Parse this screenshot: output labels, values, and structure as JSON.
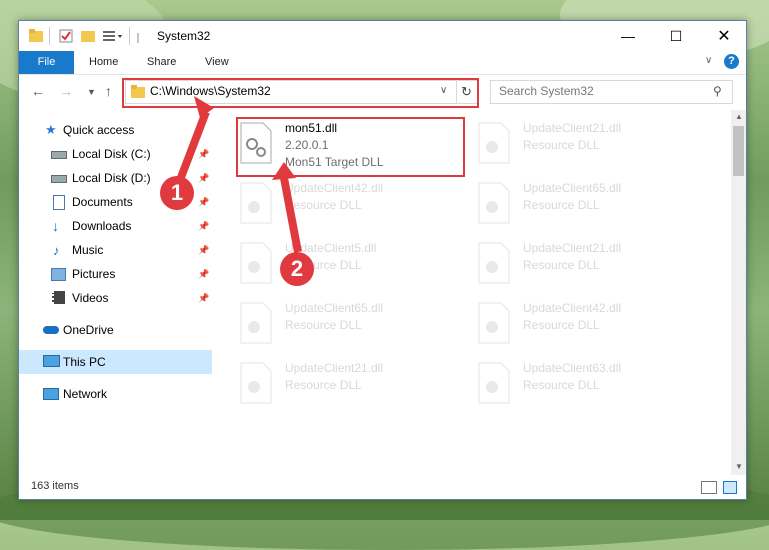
{
  "window": {
    "title": "System32"
  },
  "ribbon": {
    "tabs": [
      "File",
      "Home",
      "Share",
      "View"
    ]
  },
  "address": {
    "path": "C:\\Windows\\System32",
    "search_placeholder": "Search System32"
  },
  "nav": {
    "items": [
      {
        "label": "Quick access",
        "icon": "star-icon"
      },
      {
        "label": "Local Disk (C:)",
        "icon": "drive-icon"
      },
      {
        "label": "Local Disk (D:)",
        "icon": "drive-icon"
      },
      {
        "label": "Documents",
        "icon": "documents-icon"
      },
      {
        "label": "Downloads",
        "icon": "download-icon"
      },
      {
        "label": "Music",
        "icon": "music-icon"
      },
      {
        "label": "Pictures",
        "icon": "pictures-icon"
      },
      {
        "label": "Videos",
        "icon": "videos-icon"
      },
      {
        "label": "OneDrive",
        "icon": "cloud-icon"
      },
      {
        "label": "This PC",
        "icon": "computer-icon"
      },
      {
        "label": "Network",
        "icon": "network-icon"
      }
    ]
  },
  "files": {
    "main": {
      "name": "mon51.dll",
      "version": "2.20.0.1",
      "desc": "Mon51 Target DLL"
    },
    "faded": [
      {
        "name": "UpdateClient21.dll",
        "desc": "Resource DLL"
      },
      {
        "name": "UpdateClient42.dll",
        "desc": "Resource DLL"
      },
      {
        "name": "UpdateClient65.dll",
        "desc": "Resource DLL"
      },
      {
        "name": "UpdateClient5.dll",
        "desc": "Resource DLL"
      },
      {
        "name": "UpdateClient21.dll",
        "desc": "Resource DLL"
      },
      {
        "name": "UpdateClient65.dll",
        "desc": "Resource DLL"
      },
      {
        "name": "UpdateClient42.dll",
        "desc": "Resource DLL"
      },
      {
        "name": "UpdateClient21.dll",
        "desc": "Resource DLL"
      },
      {
        "name": "UpdateClient63.dll",
        "desc": "Resource DLL"
      }
    ]
  },
  "status": {
    "count": "163 items"
  },
  "callouts": [
    "1",
    "2"
  ],
  "colors": {
    "accent": "#1979ca",
    "highlight": "#e03a3e",
    "selected": "#cce8ff"
  }
}
